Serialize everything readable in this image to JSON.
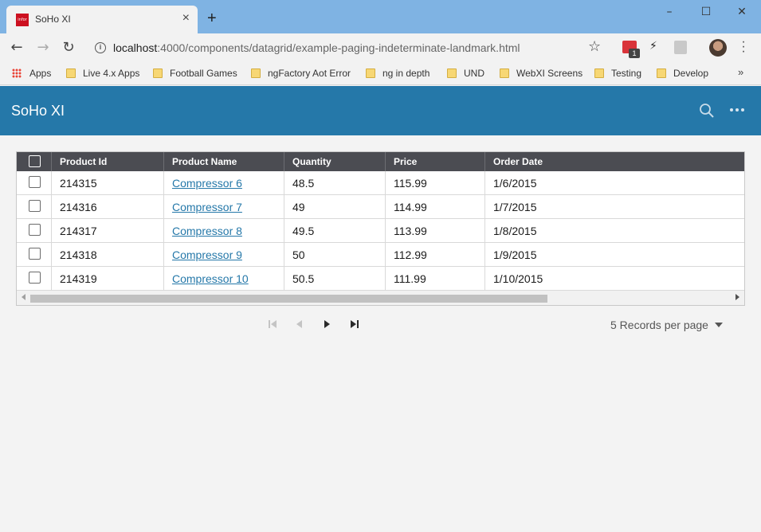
{
  "browser": {
    "tab_title": "SoHo XI",
    "tab_favicon_text": "infor",
    "url_host": "localhost",
    "url_rest": ":4000/components/datagrid/example-paging-indeterminate-landmark.html",
    "extension_badge": "1",
    "bookmarks": [
      {
        "label": "Apps",
        "icon": "apps-grid-icon"
      },
      {
        "label": "Live 4.x Apps",
        "icon": "folder-icon"
      },
      {
        "label": "Football Games",
        "icon": "folder-icon"
      },
      {
        "label": "ngFactory Aot Error",
        "icon": "folder-icon"
      },
      {
        "label": "ng in depth",
        "icon": "folder-icon"
      },
      {
        "label": "UND",
        "icon": "folder-icon"
      },
      {
        "label": "WebXI Screens",
        "icon": "folder-icon"
      },
      {
        "label": "Testing",
        "icon": "folder-icon"
      },
      {
        "label": "Develop",
        "icon": "folder-icon"
      }
    ],
    "bookmarks_more": "»"
  },
  "header": {
    "title": "SoHo XI",
    "accent": "#2578a9"
  },
  "grid": {
    "columns": [
      "Product Id",
      "Product Name",
      "Quantity",
      "Price",
      "Order Date"
    ],
    "rows": [
      {
        "id": "214315",
        "name": "Compressor 6",
        "quantity": "48.5",
        "price": "115.99",
        "date": "1/6/2015"
      },
      {
        "id": "214316",
        "name": "Compressor 7",
        "quantity": "49",
        "price": "114.99",
        "date": "1/7/2015"
      },
      {
        "id": "214317",
        "name": "Compressor 8",
        "quantity": "49.5",
        "price": "113.99",
        "date": "1/8/2015"
      },
      {
        "id": "214318",
        "name": "Compressor 9",
        "quantity": "50",
        "price": "112.99",
        "date": "1/9/2015"
      },
      {
        "id": "214319",
        "name": "Compressor 10",
        "quantity": "50.5",
        "price": "111.99",
        "date": "1/10/2015"
      }
    ]
  },
  "pager": {
    "page_size_label": "5 Records per page"
  }
}
